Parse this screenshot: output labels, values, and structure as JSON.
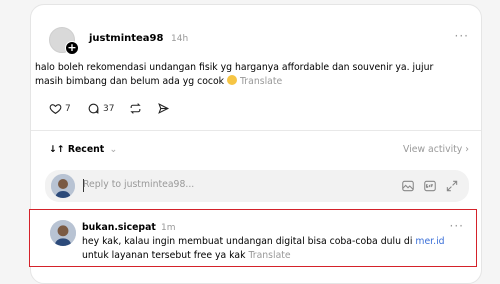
{
  "post": {
    "username": "justmintea98",
    "time": "14h",
    "more": "···",
    "text_line1": "halo boleh rekomendasi undangan fisik yg harganya affordable dan souvenir ya. jujur",
    "text_line2": "masih bimbang dan belum ada yg cocok",
    "translate": "Translate",
    "likes": "7",
    "replies": "37"
  },
  "sort": {
    "label": "Recent",
    "arrows": "↓↑",
    "chevron": "⌄",
    "view_activity": "View activity",
    "view_chevron": "›"
  },
  "reply_box": {
    "placeholder": "Reply to justmintea98..."
  },
  "comment": {
    "username": "bukan.sicepat",
    "time": "1m",
    "more": "···",
    "text_before_link": "hey kak, kalau ingin membuat undangan digital bisa coba-coba dulu di ",
    "link": "mer.id",
    "text_line2": "untuk layanan tersebut free ya kak",
    "translate": "Translate"
  },
  "colors": {
    "highlight_border": "#d4222a",
    "link": "#3a6fd8",
    "muted": "#999999"
  },
  "icons": [
    "heart-icon",
    "comment-icon",
    "repost-icon",
    "share-icon",
    "image-icon",
    "gif-icon",
    "expand-icon",
    "more-icon"
  ]
}
